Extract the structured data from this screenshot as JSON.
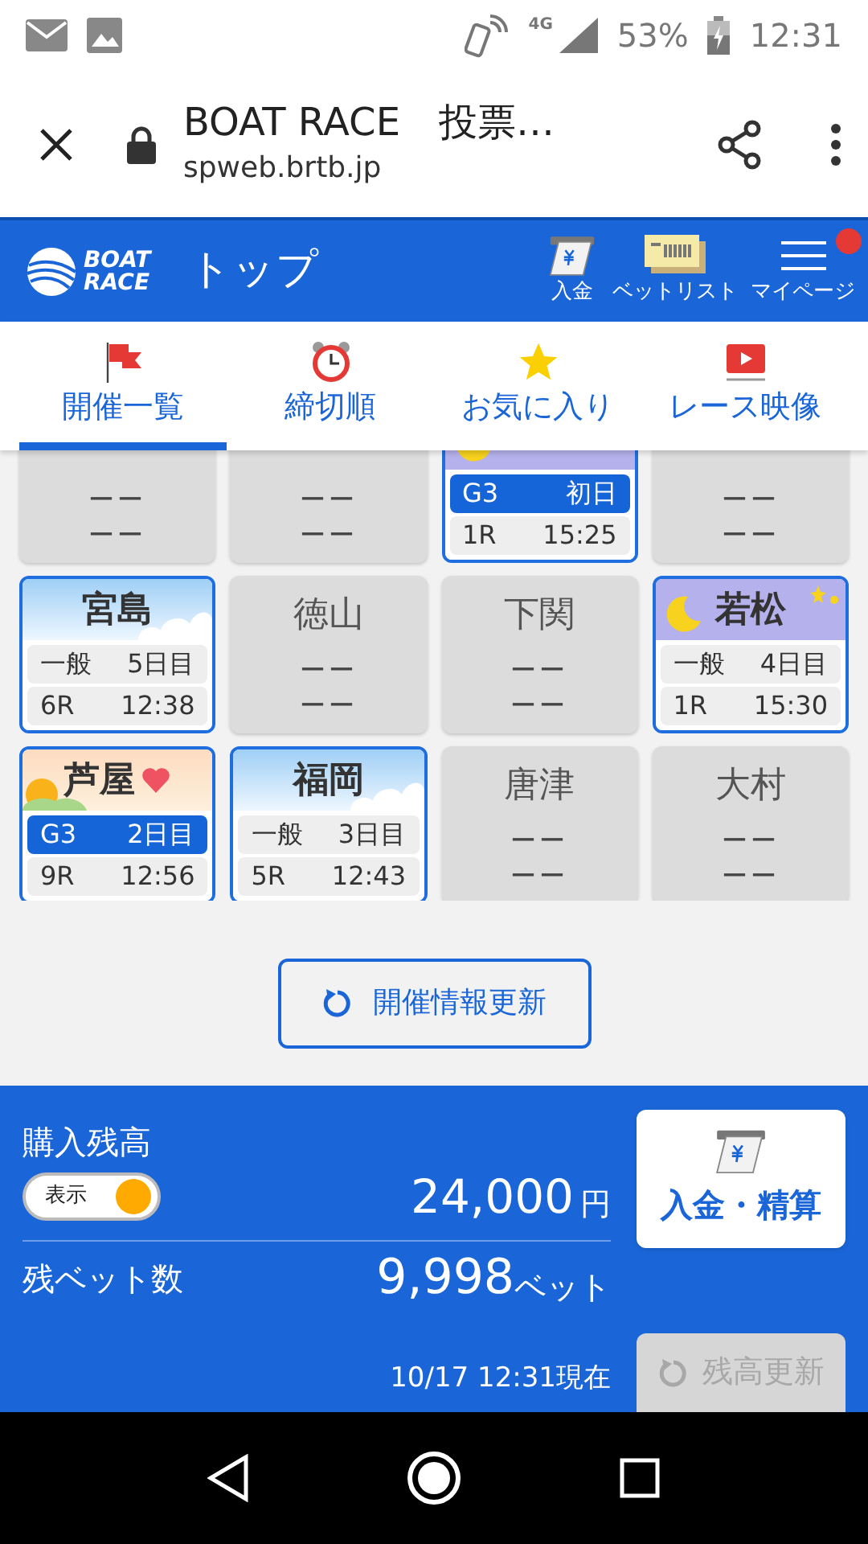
{
  "status_bar": {
    "network": "4G",
    "battery": "53%",
    "time": "12:31"
  },
  "browser": {
    "title": "BOAT RACE　投票…",
    "url": "spweb.brtb.jp"
  },
  "header": {
    "logo": [
      "BOAT",
      "RACE"
    ],
    "title": "トップ",
    "actions": [
      {
        "kind": "deposit",
        "label": "入金",
        "badge": false
      },
      {
        "kind": "betlist",
        "label": "ベットリスト",
        "badge": false
      },
      {
        "kind": "menu",
        "label": "マイページ",
        "badge": true
      }
    ]
  },
  "tabs": [
    {
      "kind": "flag",
      "label": "開催一覧",
      "selected": true
    },
    {
      "kind": "clock",
      "label": "締切順",
      "selected": false
    },
    {
      "kind": "star",
      "label": "お気に入り",
      "selected": false
    },
    {
      "kind": "video",
      "label": "レース映像",
      "selected": false
    }
  ],
  "venues": [
    {
      "kind": "closed",
      "lines": [
        "ーー",
        "ーー"
      ]
    },
    {
      "kind": "closed",
      "lines": [
        "ーー",
        "ーー"
      ]
    },
    {
      "kind": "night",
      "grade": "G3",
      "day": "初日",
      "race": "1R",
      "time": "15:25",
      "featured": true,
      "favorite": false
    },
    {
      "kind": "closed",
      "lines": [
        "ーー",
        "ーー"
      ]
    },
    {
      "kind": "day",
      "name": "宮島",
      "grade": "一般",
      "day": "5日目",
      "race": "6R",
      "time": "12:38",
      "featured": false,
      "favorite": false
    },
    {
      "kind": "closed",
      "name": "徳山",
      "lines": [
        "ーー",
        "ーー"
      ]
    },
    {
      "kind": "closed",
      "name": "下関",
      "lines": [
        "ーー",
        "ーー"
      ]
    },
    {
      "kind": "night",
      "name": "若松",
      "grade": "一般",
      "day": "4日目",
      "race": "1R",
      "time": "15:30",
      "featured": false,
      "favorite": false
    },
    {
      "kind": "morning",
      "name": "芦屋",
      "grade": "G3",
      "day": "2日目",
      "race": "9R",
      "time": "12:56",
      "featured": true,
      "favorite": true
    },
    {
      "kind": "day",
      "name": "福岡",
      "grade": "一般",
      "day": "3日目",
      "race": "5R",
      "time": "12:43",
      "featured": false,
      "favorite": false
    },
    {
      "kind": "closed",
      "name": "唐津",
      "lines": [
        "ーー",
        "ーー"
      ]
    },
    {
      "kind": "closed",
      "name": "大村",
      "lines": [
        "ーー",
        "ーー"
      ]
    }
  ],
  "refresh_button": "開催情報更新",
  "balance": {
    "label": "購入残高",
    "toggle": {
      "label": "表示",
      "on": true
    },
    "amount": "24,000",
    "unit": "円",
    "bets_label": "残ベット数",
    "bets": "9,998",
    "bets_unit": "ベット",
    "timestamp": "10/17 12:31現在",
    "deposit_button": "入金・精算",
    "update_button": {
      "label": "残高更新",
      "disabled": true
    }
  }
}
